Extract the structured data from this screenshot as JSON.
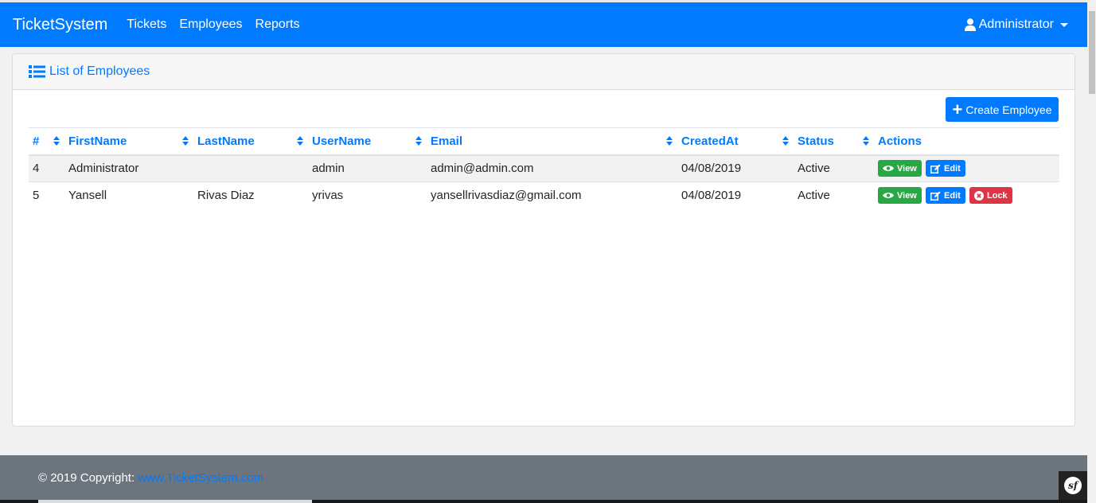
{
  "navbar": {
    "brand": "TicketSystem",
    "links": [
      "Tickets",
      "Employees",
      "Reports"
    ],
    "user": "Administrator"
  },
  "card": {
    "title": "List of Employees",
    "create_button": "Create Employee"
  },
  "table": {
    "headers": [
      "#",
      "FirstName",
      "LastName",
      "UserName",
      "Email",
      "CreatedAt",
      "Status",
      "Actions"
    ],
    "rows": [
      {
        "id": "4",
        "firstname": "Administrator",
        "lastname": "",
        "username": "admin",
        "email": "admin@admin.com",
        "created": "04/08/2019",
        "status": "Active"
      },
      {
        "id": "5",
        "firstname": "Yansell",
        "lastname": "Rivas Diaz",
        "username": "yrivas",
        "email": "yansellrivasdiaz@gmail.com",
        "created": "04/08/2019",
        "status": "Active"
      }
    ],
    "actions": {
      "view": "View",
      "edit": "Edit",
      "lock": "Lock"
    }
  },
  "footer": {
    "copyright": "© 2019 Copyright:",
    "link": "www.TicketSystem.com"
  },
  "colors": {
    "primary": "#007bff",
    "success": "#28a745",
    "danger": "#dc3545",
    "footer": "#6c757d"
  }
}
